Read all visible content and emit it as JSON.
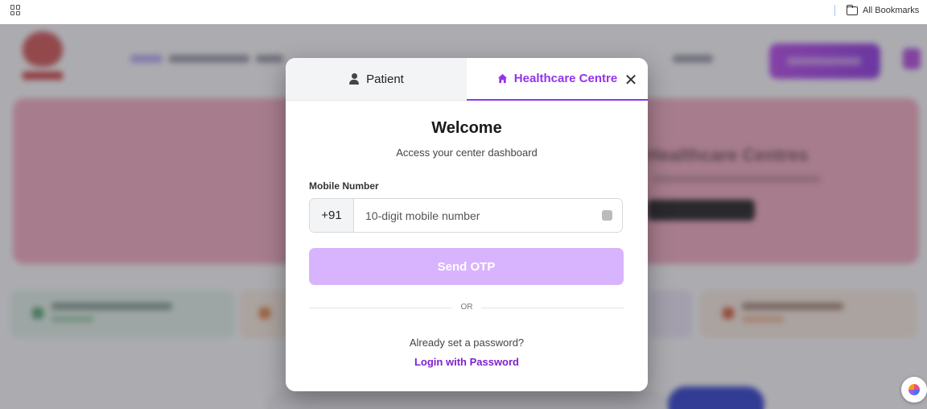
{
  "bookmarks_bar": {
    "all_bookmarks_label": "All Bookmarks"
  },
  "hero": {
    "title": "Healthcare Centres"
  },
  "modal": {
    "tabs": [
      {
        "label": "Patient",
        "icon": "person-icon",
        "active": false
      },
      {
        "label": "Healthcare Centre",
        "icon": "home-icon",
        "active": true
      }
    ],
    "close_glyph": "✕",
    "title": "Welcome",
    "subtitle": "Access your center dashboard",
    "mobile_label": "Mobile Number",
    "country_code": "+91",
    "mobile_placeholder": "10-digit mobile number",
    "mobile_value": "",
    "send_otp_label": "Send OTP",
    "divider_text": "OR",
    "already_text": "Already set a password?",
    "password_link": "Login with Password",
    "colors": {
      "accent": "#9333ea",
      "send_otp_bg": "#d8b4fe",
      "link": "#7e22ce"
    }
  }
}
